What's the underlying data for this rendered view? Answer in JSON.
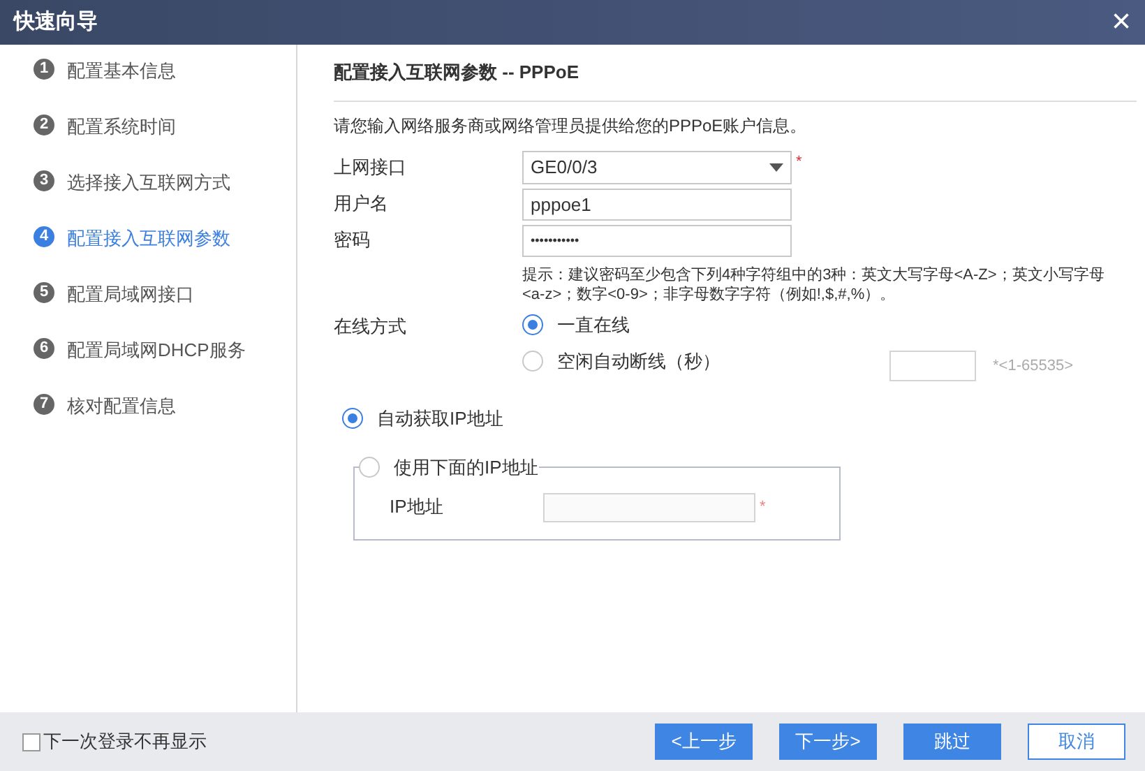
{
  "window": {
    "title": "快速向导",
    "close": "×"
  },
  "steps": [
    {
      "number": "1",
      "label": "配置基本信息",
      "selected": false
    },
    {
      "number": "2",
      "label": "配置系统时间",
      "selected": false
    },
    {
      "number": "3",
      "label": "选择接入互联网方式",
      "selected": false
    },
    {
      "number": "4",
      "label": "配置接入互联网参数",
      "selected": true
    },
    {
      "number": "5",
      "label": "配置局域网接口",
      "selected": false
    },
    {
      "number": "6",
      "label": "配置局域网DHCP服务",
      "selected": false
    },
    {
      "number": "7",
      "label": "核对配置信息",
      "selected": false
    }
  ],
  "section_title": "配置接入互联网参数 -- PPPoE",
  "intro": "请您输入网络服务商或网络管理员提供给您的PPPoE账户信息。",
  "interface": {
    "label": "上网接口",
    "value": "GE0/0/3",
    "required": "*"
  },
  "username": {
    "label": "用户名",
    "value": "pppoe1"
  },
  "password": {
    "label": "密码",
    "value": "•••••••••••"
  },
  "hint": "提示：建议密码至少包含下列4种字符组中的3种：英文大写字母<A-Z>；英文小写字母<a-z>；数字<0-9>；非字母数字字符（例如!,$,#,%）。",
  "online_mode": {
    "label": "在线方式",
    "options": [
      {
        "label": "一直在线",
        "selected": true
      },
      {
        "label": "空闲自动断线（秒）",
        "selected": false
      }
    ],
    "idle_range": "*<1-65535>"
  },
  "ip_options": [
    {
      "label": "自动获取IP地址",
      "selected": true
    },
    {
      "label": "使用下面的IP地址",
      "selected": false
    }
  ],
  "ip_address": {
    "label": "IP地址",
    "required": "*"
  },
  "footer": {
    "dont_show": {
      "label": "下一次登录不再显示",
      "checked": false
    },
    "buttons": [
      {
        "label": "<上一步",
        "kind": "primary"
      },
      {
        "label": "下一步>",
        "kind": "primary"
      },
      {
        "label": "跳过",
        "kind": "primary"
      },
      {
        "label": "取消",
        "kind": "outline"
      }
    ]
  }
}
